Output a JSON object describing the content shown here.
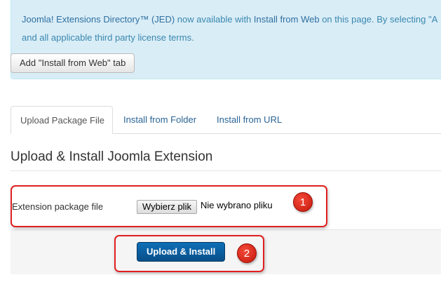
{
  "alert": {
    "jed_link": "Joomla! Extensions Directory™ (JED)",
    "text_mid": " now available with ",
    "install_web_link": "Install from Web",
    "text_end": " on this page.  By selecting \"A",
    "line2": "and all applicable third party license terms.",
    "button_label": "Add \"Install from Web\" tab"
  },
  "tabs": [
    {
      "label": "Upload Package File",
      "active": true
    },
    {
      "label": "Install from Folder",
      "active": false
    },
    {
      "label": "Install from URL",
      "active": false
    }
  ],
  "section": {
    "title": "Upload & Install Joomla Extension"
  },
  "form": {
    "field_label": "Extension package file",
    "file_button_label": "Wybierz plik",
    "file_status": "Nie wybrano pliku",
    "submit_label": "Upload & Install"
  },
  "annotations": {
    "badge1": "1",
    "badge2": "2",
    "color": "#e02020"
  },
  "colors": {
    "alert_bg": "#d9edf7",
    "link": "#2a6496",
    "primary": "#0b5fa0"
  }
}
